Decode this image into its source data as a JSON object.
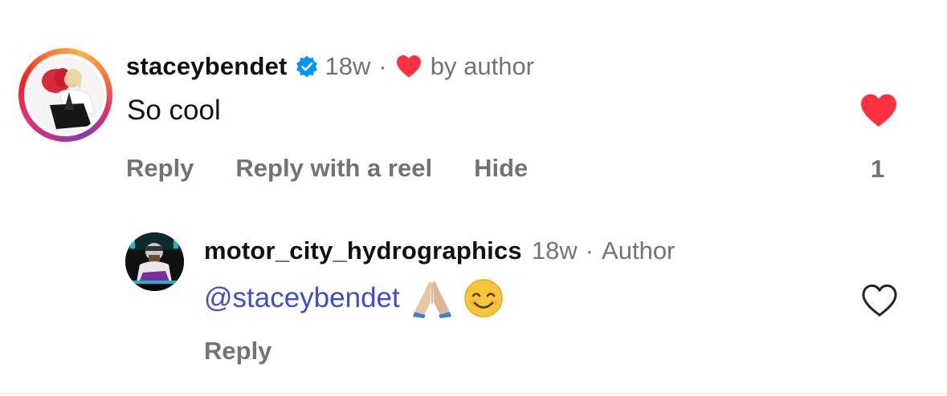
{
  "comment": {
    "username": "staceybendet",
    "age": "18w",
    "liked_by_author_label": "by author",
    "text": "So cool",
    "actions": {
      "reply": "Reply",
      "reply_with_reel": "Reply with a reel",
      "hide": "Hide"
    },
    "like_count": "1",
    "liked": true,
    "verified": true
  },
  "reply": {
    "username": "motor_city_hydrographics",
    "age": "18w",
    "role_label": "Author",
    "mention": "@staceybendet",
    "emojis": [
      "folded-hands-emoji",
      "smiling-face-emoji"
    ],
    "actions": {
      "reply": "Reply"
    },
    "liked": false
  },
  "colors": {
    "heart_red": "#ff3040",
    "verified_blue": "#0095f6",
    "mention_blue": "#3b4fc9",
    "secondary_text": "#737373"
  }
}
